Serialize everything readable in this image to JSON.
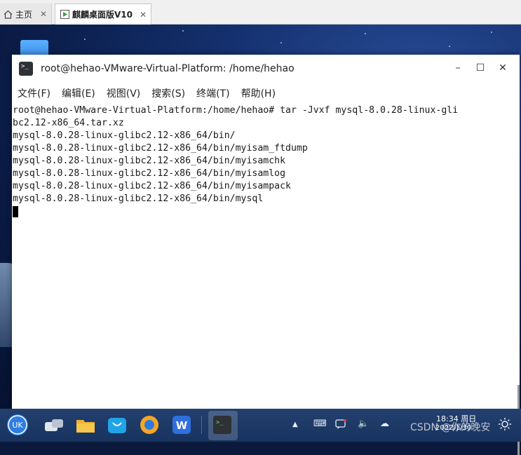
{
  "tabs": [
    {
      "label": "主页",
      "icon": "home-icon",
      "close": "✕"
    },
    {
      "label": "麒麟桌面版V10",
      "icon": "vm-play-icon",
      "close": "✕"
    }
  ],
  "window": {
    "title": "root@hehao-VMware-Virtual-Platform: /home/hehao",
    "controls": {
      "minimize": "–",
      "maximize": "☐",
      "close": "✕"
    },
    "menu": [
      "文件(F)",
      "编辑(E)",
      "视图(V)",
      "搜索(S)",
      "终端(T)",
      "帮助(H)"
    ]
  },
  "terminal": {
    "lines": [
      "root@hehao-VMware-Virtual-Platform:/home/hehao# tar -Jvxf mysql-8.0.28-linux-gli",
      "bc2.12-x86_64.tar.xz",
      "mysql-8.0.28-linux-glibc2.12-x86_64/bin/",
      "mysql-8.0.28-linux-glibc2.12-x86_64/bin/myisam_ftdump",
      "mysql-8.0.28-linux-glibc2.12-x86_64/bin/myisamchk",
      "mysql-8.0.28-linux-glibc2.12-x86_64/bin/myisamlog",
      "mysql-8.0.28-linux-glibc2.12-x86_64/bin/myisampack",
      "mysql-8.0.28-linux-glibc2.12-x86_64/bin/mysql"
    ]
  },
  "taskbar": {
    "apps": [
      {
        "name": "start-menu-icon",
        "color": "#2f7de1"
      },
      {
        "name": "multitask-view-icon",
        "color": "#dfe6ef"
      },
      {
        "name": "file-manager-icon",
        "color": "#f2b233"
      },
      {
        "name": "software-store-icon",
        "color": "#1fa4e8"
      },
      {
        "name": "browser-icon",
        "color": "#f5a623"
      },
      {
        "name": "wps-writer-icon",
        "color": "#2f6fde"
      },
      {
        "name": "terminal-icon",
        "color": "#2e3136"
      }
    ],
    "tray": {
      "up_arrow": "▲",
      "keyboard": "⌨",
      "volume": "🔈",
      "weather": "☁"
    },
    "clock": {
      "time": "18:34 周日",
      "date": "2022/1/30"
    },
    "watermark": "CSDN @你的晚安"
  }
}
